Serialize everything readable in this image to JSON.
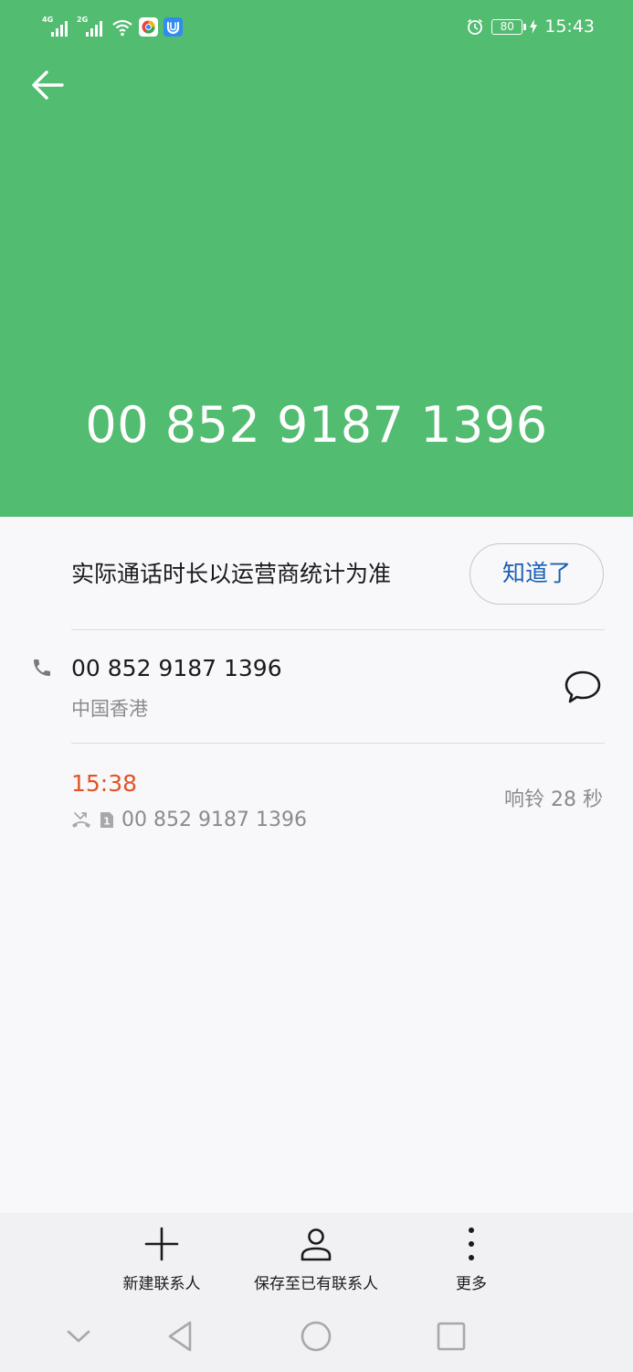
{
  "status_bar": {
    "network_1": "4G",
    "network_2": "2G",
    "battery": "80",
    "time": "15:43"
  },
  "header": {
    "phone_number": "00 852 9187 1396"
  },
  "notice": {
    "text": "实际通话时长以运营商统计为准",
    "ok_label": "知道了"
  },
  "contact": {
    "number": "00 852 9187 1396",
    "region": "中国香港"
  },
  "call_log": [
    {
      "time": "15:38",
      "sim": "1",
      "number": "00 852 9187 1396",
      "ring_duration": "响铃 28 秒"
    }
  ],
  "actions": {
    "new_contact": "新建联系人",
    "save_existing": "保存至已有联系人",
    "more": "更多"
  },
  "icons": {
    "back": "arrow-left",
    "phone": "phone-handset",
    "message": "speech-bubble",
    "missed_call": "missed-call",
    "sim": "sim-card",
    "new_contact": "plus",
    "save_existing": "person",
    "more": "vertical-dots"
  },
  "colors": {
    "header_green": "#52bc71",
    "accent_blue": "#1a5fb4",
    "missed_red": "#e25425"
  }
}
